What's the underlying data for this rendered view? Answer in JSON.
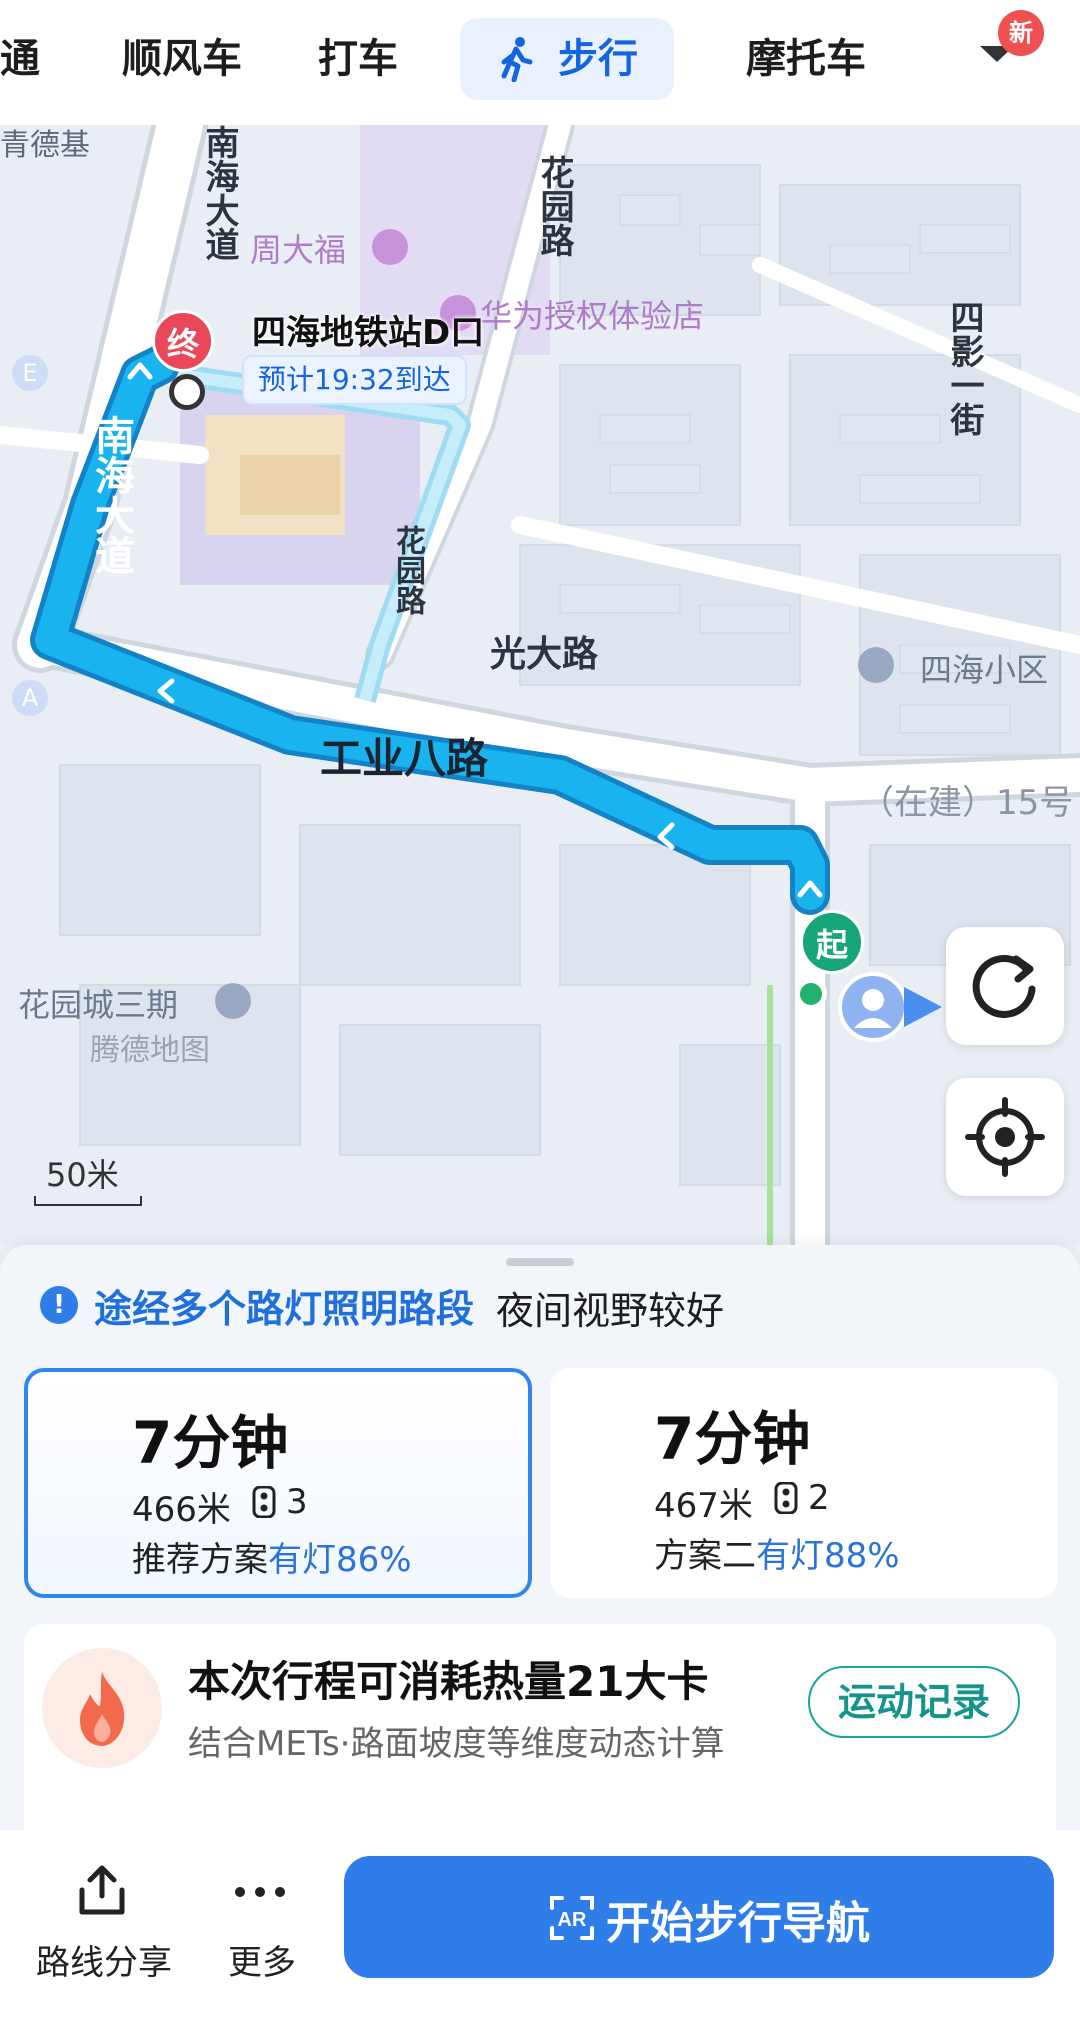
{
  "tabs": {
    "partial": "通",
    "shunfeng": "顺风车",
    "dache": "打车",
    "walk": "步行",
    "moto": "摩托车",
    "new_badge": "新"
  },
  "map": {
    "labels": {
      "top_left": "青德基",
      "road_nanhai_top": "南海大道",
      "road_nanhai_side": "南海大道",
      "road_huayuan_top": "花园路",
      "road_huayuan_mid": "花园路",
      "road_guangda": "光大路",
      "road_gongye8": "工业八路",
      "road_siying": "四影一街",
      "poi_chowtaifook": "周大福",
      "poi_huawei": "华为授权体验店",
      "poi_sihai": "四海小区",
      "poi_huayuancheng": "花园城三期",
      "construction": "（在建）15号",
      "watermark": "腾德地图",
      "badge_e": "E",
      "badge_a": "A"
    },
    "destination": "四海地铁站D口",
    "eta": "预计19:32到达",
    "end_marker": "终",
    "start_marker": "起",
    "scale": "50米"
  },
  "notice": {
    "highlight": "途经多个路灯照明路段",
    "text": "夜间视野较好"
  },
  "plans": [
    {
      "time": "7分钟",
      "distance": "466米",
      "lights": "3",
      "name": "推荐方案",
      "pct": "有灯86%"
    },
    {
      "time": "7分钟",
      "distance": "467米",
      "lights": "2",
      "name": "方案二",
      "pct": "有灯88%"
    }
  ],
  "calories": {
    "title": "本次行程可消耗热量21大卡",
    "subtitle": "结合METs·路面坡度等维度动态计算",
    "button": "运动记录"
  },
  "bottom": {
    "share": "路线分享",
    "more": "更多",
    "navigate": "开始步行导航"
  },
  "colors": {
    "accent": "#2f7de8",
    "route": "#19b3ef",
    "end_marker": "#e84858",
    "start_marker": "#17a67a"
  }
}
